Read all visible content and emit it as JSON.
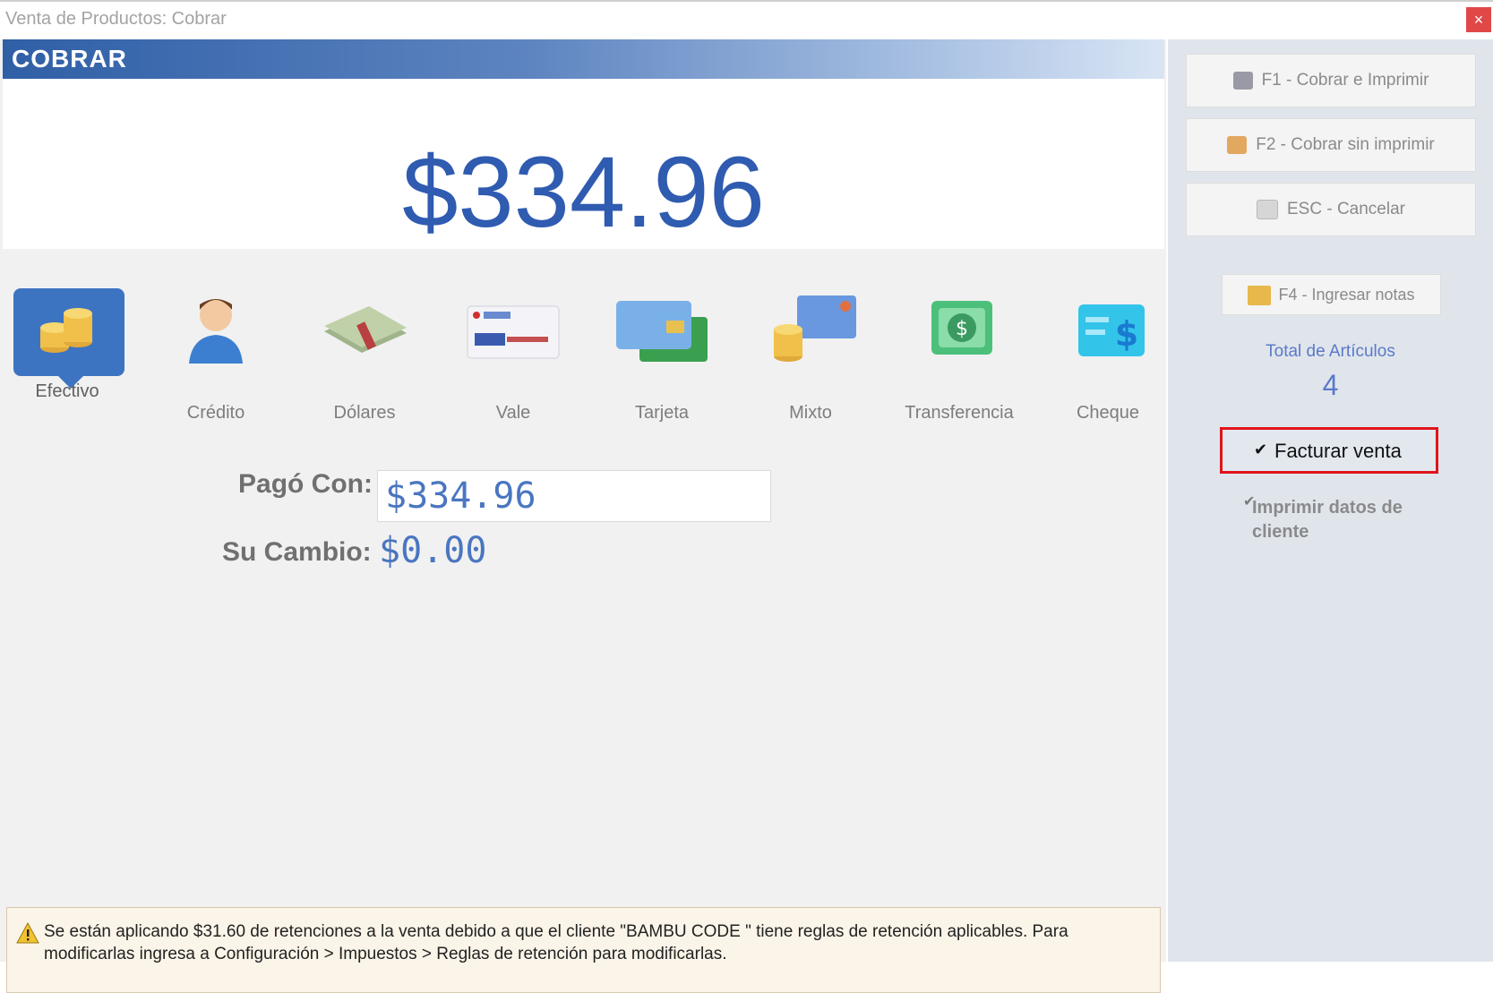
{
  "window": {
    "title": "Venta de Productos: Cobrar",
    "close_label": "×"
  },
  "header": {
    "title": "COBRAR"
  },
  "amount": "$334.96",
  "payment_methods": [
    {
      "label": "Efectivo",
      "icon": "cash-coins-icon",
      "selected": true
    },
    {
      "label": "Crédito",
      "icon": "customer-credit-icon",
      "selected": false
    },
    {
      "label": "Dólares",
      "icon": "dollar-bills-icon",
      "selected": false
    },
    {
      "label": "Vale",
      "icon": "voucher-icon",
      "selected": false
    },
    {
      "label": "Tarjeta",
      "icon": "card-icon",
      "selected": false
    },
    {
      "label": "Mixto",
      "icon": "mixed-payment-icon",
      "selected": false
    },
    {
      "label": "Transferencia",
      "icon": "transfer-icon",
      "selected": false
    },
    {
      "label": "Cheque",
      "icon": "check-icon",
      "selected": false
    }
  ],
  "payment": {
    "paid_with_label": "Pagó Con:",
    "paid_with_value": "$334.96",
    "change_label": "Su Cambio:",
    "change_value": "$0.00"
  },
  "warning": {
    "text": "Se están aplicando $31.60 de retenciones a la venta debido a que el cliente \"BAMBU CODE \" tiene reglas de retención aplicables. Para modificarlas ingresa a Configuración > Impuestos > Reglas de retención para modificarlas."
  },
  "sidebar": {
    "buttons": [
      {
        "label": "F1 - Cobrar e Imprimir",
        "icon": "printer-icon"
      },
      {
        "label": "F2 - Cobrar sin imprimir",
        "icon": "hand-icon"
      },
      {
        "label": "ESC - Cancelar",
        "icon": "escape-key-icon"
      }
    ],
    "notes_button": "F4 - Ingresar notas",
    "total_label": "Total de Artículos",
    "total_value": "4",
    "facturar_label": "Facturar venta",
    "facturar_checked": true,
    "imprimir_label": "Imprimir datos de cliente",
    "imprimir_checked": true
  },
  "colors": {
    "accent": "#2f5bb0",
    "selected_method": "#3d74c2",
    "highlight_border": "#e0141c",
    "warning_bg": "#fbf4e8"
  }
}
